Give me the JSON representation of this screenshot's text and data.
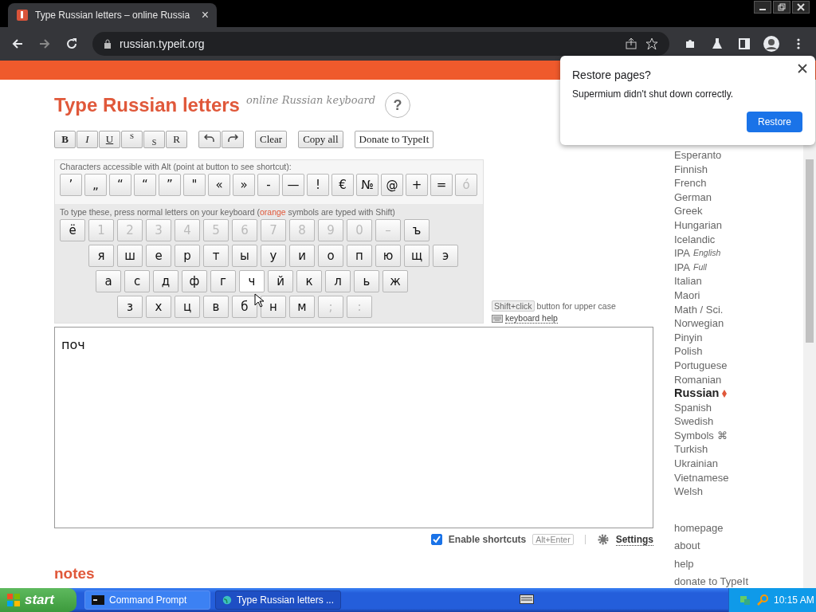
{
  "browser": {
    "tab": {
      "title": "Type Russian letters – online Russia",
      "close": "×"
    },
    "url": "russian.typeit.org"
  },
  "page": {
    "title": "Type Russian letters",
    "subtitle": "online Russian keyboard",
    "help": "?",
    "format_buttons": [
      {
        "label": "B",
        "kind": "bold"
      },
      {
        "label": "I",
        "kind": "italic"
      },
      {
        "label": "U",
        "kind": "underline"
      },
      {
        "label": "S",
        "kind": "sup"
      },
      {
        "label": "S",
        "kind": "sub"
      },
      {
        "label": "R",
        "kind": "plain"
      }
    ],
    "actions": [
      {
        "label": "Clear",
        "kind": "action"
      },
      {
        "label": "Copy all",
        "kind": "action"
      },
      {
        "label": "Donate to TypeIt",
        "kind": "donate"
      }
    ],
    "alt_caption": "Characters accessible with Alt (point at button to see shortcut):",
    "alt_keys": [
      {
        "label": "’",
        "disabled": false
      },
      {
        "label": "„",
        "disabled": false
      },
      {
        "label": "“",
        "disabled": false
      },
      {
        "label": "“",
        "disabled": false
      },
      {
        "label": "”",
        "disabled": false
      },
      {
        "label": "\"",
        "disabled": false
      },
      {
        "label": "«",
        "disabled": false
      },
      {
        "label": "»",
        "disabled": false
      },
      {
        "label": "-",
        "disabled": false
      },
      {
        "label": "—",
        "disabled": false
      },
      {
        "label": "!",
        "disabled": false
      },
      {
        "label": "€",
        "disabled": false
      },
      {
        "label": "№",
        "disabled": false
      },
      {
        "label": "@",
        "disabled": false
      },
      {
        "label": "+",
        "disabled": false
      },
      {
        "label": "=",
        "disabled": false
      },
      {
        "label": "ó",
        "disabled": true
      }
    ],
    "keys_caption": {
      "before": "To type these, press normal letters on your keyboard (",
      "highlight": "orange",
      "after": " symbols are typed with Shift)"
    },
    "key_rows": [
      [
        {
          "label": "ё",
          "disabled": false
        },
        {
          "label": "1",
          "disabled": true
        },
        {
          "label": "2",
          "disabled": true
        },
        {
          "label": "3",
          "disabled": true
        },
        {
          "label": "4",
          "disabled": true
        },
        {
          "label": "5",
          "disabled": true
        },
        {
          "label": "6",
          "disabled": true
        },
        {
          "label": "7",
          "disabled": true
        },
        {
          "label": "8",
          "disabled": true
        },
        {
          "label": "9",
          "disabled": true
        },
        {
          "label": "0",
          "disabled": true
        },
        {
          "label": "–",
          "disabled": true
        },
        {
          "label": "ъ",
          "disabled": false
        }
      ],
      [
        {
          "label": "я",
          "disabled": false
        },
        {
          "label": "ш",
          "disabled": false
        },
        {
          "label": "е",
          "disabled": false
        },
        {
          "label": "р",
          "disabled": false
        },
        {
          "label": "т",
          "disabled": false
        },
        {
          "label": "ы",
          "disabled": false
        },
        {
          "label": "у",
          "disabled": false
        },
        {
          "label": "и",
          "disabled": false
        },
        {
          "label": "о",
          "disabled": false
        },
        {
          "label": "п",
          "disabled": false
        },
        {
          "label": "ю",
          "disabled": false
        },
        {
          "label": "щ",
          "disabled": false
        },
        {
          "label": "э",
          "disabled": false
        }
      ],
      [
        {
          "label": "а",
          "disabled": false
        },
        {
          "label": "с",
          "disabled": false
        },
        {
          "label": "д",
          "disabled": false
        },
        {
          "label": "ф",
          "disabled": false
        },
        {
          "label": "г",
          "disabled": false
        },
        {
          "label": "ч",
          "disabled": false,
          "hovered": true
        },
        {
          "label": "й",
          "disabled": false
        },
        {
          "label": "к",
          "disabled": false
        },
        {
          "label": "л",
          "disabled": false
        },
        {
          "label": "ь",
          "disabled": false
        },
        {
          "label": "ж",
          "disabled": false
        }
      ],
      [
        {
          "label": "з",
          "disabled": false
        },
        {
          "label": "х",
          "disabled": false
        },
        {
          "label": "ц",
          "disabled": false
        },
        {
          "label": "в",
          "disabled": false
        },
        {
          "label": "б",
          "disabled": false
        },
        {
          "label": "н",
          "disabled": false
        },
        {
          "label": "м",
          "disabled": false
        },
        {
          "label": ";",
          "disabled": true
        },
        {
          "label": ":",
          "disabled": true
        }
      ]
    ],
    "shift_hint": {
      "key": "Shift+click",
      "text": "button for upper case"
    },
    "keyboard_help": "keyboard help",
    "editor": {
      "value": "поч"
    },
    "shortcuts": {
      "label": "Enable shortcuts",
      "checked": true,
      "key": "Alt+Enter"
    },
    "settings": "Settings",
    "notes_heading": "notes"
  },
  "sidebar": {
    "languages": [
      {
        "label": "Esperanto",
        "selected": false
      },
      {
        "label": "Finnish",
        "selected": false
      },
      {
        "label": "French",
        "selected": false
      },
      {
        "label": "German",
        "selected": false
      },
      {
        "label": "Greek",
        "selected": false
      },
      {
        "label": "Hungarian",
        "selected": false
      },
      {
        "label": "Icelandic",
        "selected": false
      },
      {
        "label": "IPA",
        "note": "English",
        "selected": false
      },
      {
        "label": "IPA",
        "note": "Full",
        "selected": false
      },
      {
        "label": "Italian",
        "selected": false
      },
      {
        "label": "Maori",
        "selected": false
      },
      {
        "label": "Math / Sci.",
        "selected": false
      },
      {
        "label": "Norwegian",
        "selected": false
      },
      {
        "label": "Pinyin",
        "selected": false
      },
      {
        "label": "Polish",
        "selected": false
      },
      {
        "label": "Portuguese",
        "selected": false
      },
      {
        "label": "Romanian",
        "selected": false
      },
      {
        "label": "Russian",
        "selected": true
      },
      {
        "label": "Spanish",
        "selected": false
      },
      {
        "label": "Swedish",
        "selected": false
      },
      {
        "label": "Symbols",
        "symbol": "⌘",
        "selected": false
      },
      {
        "label": "Turkish",
        "selected": false
      },
      {
        "label": "Ukrainian",
        "selected": false
      },
      {
        "label": "Vietnamese",
        "selected": false
      },
      {
        "label": "Welsh",
        "selected": false
      }
    ],
    "links": [
      "homepage",
      "about",
      "help",
      "donate to TypeIt"
    ]
  },
  "popup": {
    "title": "Restore pages?",
    "message": "Supermium didn't shut down correctly.",
    "button": "Restore"
  },
  "taskbar": {
    "start": "start",
    "tasks": [
      {
        "label": "Command Prompt",
        "kind": "console",
        "selected": false
      },
      {
        "label": "Type Russian letters ...",
        "kind": "browser",
        "selected": true
      }
    ],
    "time": "10:15 AM"
  }
}
